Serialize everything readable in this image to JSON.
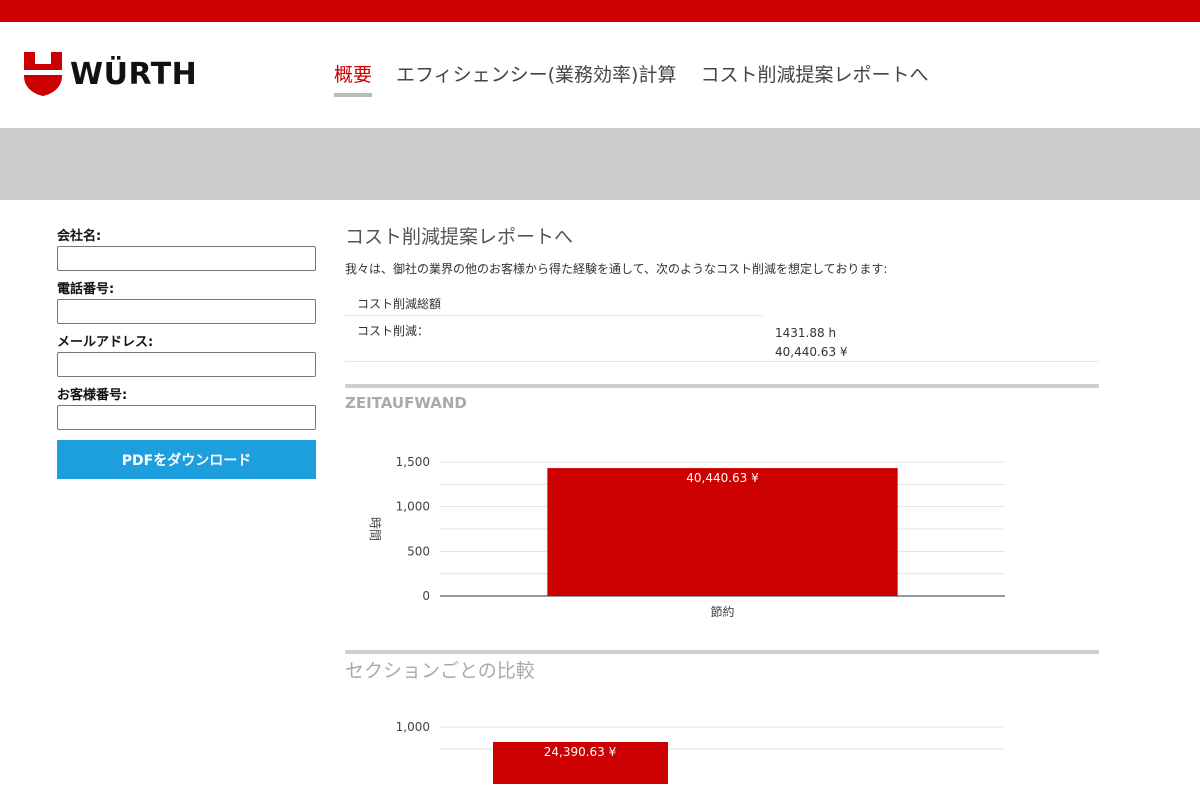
{
  "brand": {
    "name": "WÜRTH",
    "accent": "#cc0000"
  },
  "nav": {
    "items": [
      "概要",
      "エフィシェンシー(業務効率)計算",
      "コスト削減提案レポートへ"
    ],
    "active": 0
  },
  "form": {
    "company_label": "会社名:",
    "phone_label": "電話番号:",
    "email_label": "メールアドレス:",
    "customer_label": "お客様番号:",
    "company_value": "",
    "phone_value": "",
    "email_value": "",
    "customer_value": "",
    "pdf_button": "PDFをダウンロード"
  },
  "report": {
    "title": "コスト削減提案レポートへ",
    "intro": "我々は、御社の業界の他のお客様から得た経験を通して、次のようなコスト削減を想定しております:",
    "total_label": "コスト削減総額",
    "saving_label": "コスト削減：",
    "saving_hours": "1431.88 h",
    "saving_yen": "40,440.63 ¥",
    "section_time": "ZEITAUFWAND",
    "section_compare": "セクションごとの比較"
  },
  "chart_data": [
    {
      "type": "bar",
      "categories": [
        "節約"
      ],
      "values": [
        1431.88
      ],
      "data_labels": [
        "40,440.63 ¥"
      ],
      "ylabel": "時間",
      "xlabel": "",
      "ylim": [
        0,
        1500
      ],
      "yticks": [
        0,
        500,
        1000,
        1500
      ],
      "ytick_labels": [
        "0",
        "500",
        "1,000",
        "1,500"
      ],
      "grid": true,
      "color": "#cc0000"
    },
    {
      "type": "bar",
      "data_labels": [
        "24,390.63 ¥"
      ],
      "yticks": [
        1000
      ],
      "ytick_labels": [
        "1,000"
      ],
      "grid": true,
      "color": "#cc0000"
    }
  ]
}
